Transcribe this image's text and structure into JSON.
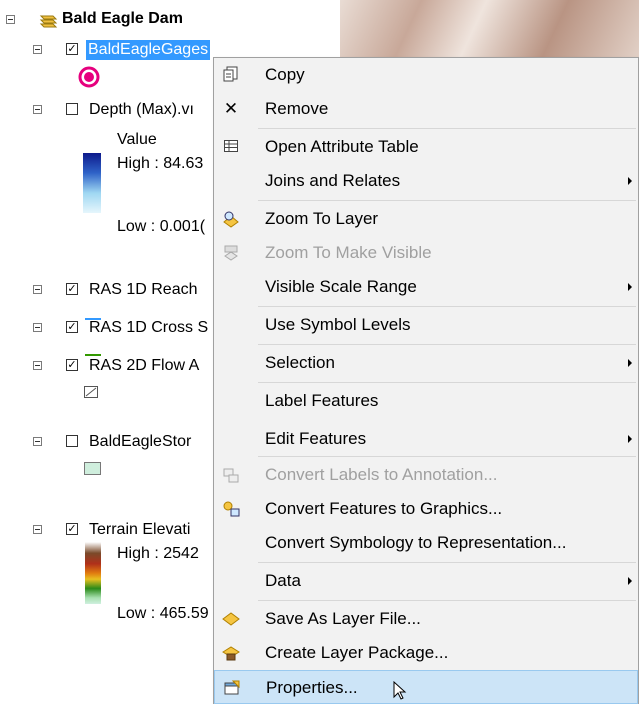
{
  "toc": {
    "group_title": "Bald Eagle Dam",
    "layers": [
      {
        "name": "BaldEagleGages",
        "checked": true,
        "selected": true
      },
      {
        "name": "Depth (Max).vı",
        "checked": false
      },
      {
        "name": "RAS 1D Reach",
        "checked": true
      },
      {
        "name": "RAS 1D Cross S",
        "checked": true
      },
      {
        "name": "RAS 2D Flow A",
        "checked": true
      },
      {
        "name": "BaldEagleStor",
        "checked": false
      },
      {
        "name": "Terrain Elevati",
        "checked": true
      }
    ],
    "depth_legend": {
      "heading": "Value",
      "high": "High : 84.63",
      "low": "Low : 0.001("
    },
    "terrain_legend": {
      "high": "High : 2542",
      "low": "Low : 465.59"
    }
  },
  "menu": {
    "items": [
      {
        "label": "Copy",
        "icon": "copy-icon",
        "enabled": true,
        "submenu": false
      },
      {
        "label": "Remove",
        "icon": "remove-icon",
        "enabled": true,
        "submenu": false
      },
      {
        "label": "Open Attribute Table",
        "icon": "table-icon",
        "enabled": true,
        "submenu": false
      },
      {
        "label": "Joins and Relates",
        "icon": "",
        "enabled": true,
        "submenu": true
      },
      {
        "label": "Zoom To Layer",
        "icon": "zoom-layer-icon",
        "enabled": true,
        "submenu": false
      },
      {
        "label": "Zoom To Make Visible",
        "icon": "zoom-visible-icon",
        "enabled": false,
        "submenu": false
      },
      {
        "label": "Visible Scale Range",
        "icon": "",
        "enabled": true,
        "submenu": true
      },
      {
        "label": "Use Symbol Levels",
        "icon": "",
        "enabled": true,
        "submenu": false
      },
      {
        "label": "Selection",
        "icon": "",
        "enabled": true,
        "submenu": true
      },
      {
        "label": "Label Features",
        "icon": "",
        "enabled": true,
        "submenu": false
      },
      {
        "label": "Edit Features",
        "icon": "",
        "enabled": true,
        "submenu": true
      },
      {
        "label": "Convert Labels to Annotation...",
        "icon": "convert-labels-icon",
        "enabled": false,
        "submenu": false
      },
      {
        "label": "Convert Features to Graphics...",
        "icon": "convert-graphics-icon",
        "enabled": true,
        "submenu": false
      },
      {
        "label": "Convert Symbology to Representation...",
        "icon": "",
        "enabled": true,
        "submenu": false
      },
      {
        "label": "Data",
        "icon": "",
        "enabled": true,
        "submenu": true
      },
      {
        "label": "Save As Layer File...",
        "icon": "layer-file-icon",
        "enabled": true,
        "submenu": false
      },
      {
        "label": "Create Layer Package...",
        "icon": "layer-package-icon",
        "enabled": true,
        "submenu": false
      },
      {
        "label": "Properties...",
        "icon": "properties-icon",
        "enabled": true,
        "submenu": false,
        "hovered": true
      }
    ]
  },
  "colors": {
    "selection": "#3399ff",
    "menu_hover": "#cce4f7",
    "gage_symbol": "#e6007e",
    "reach_line": "#3399ff",
    "cross_section_line": "#339900"
  }
}
